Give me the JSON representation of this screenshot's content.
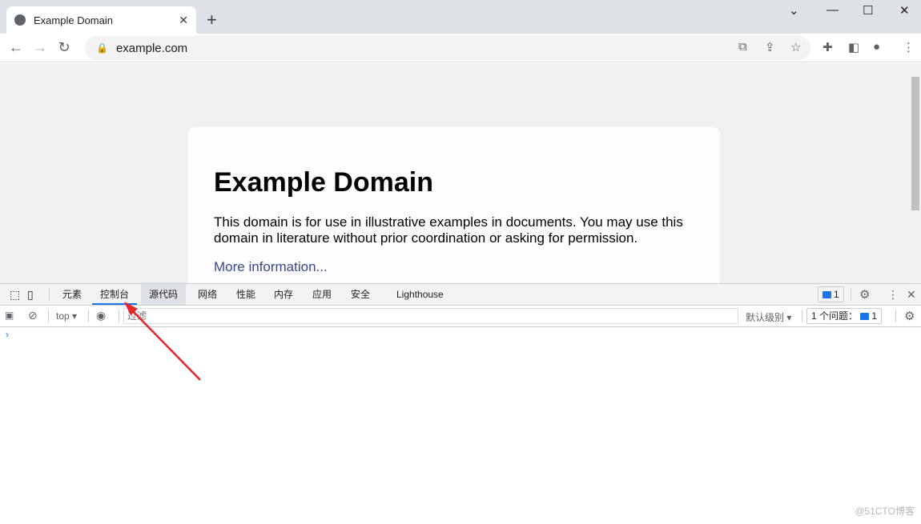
{
  "browser": {
    "tab_title": "Example Domain",
    "url": "example.com"
  },
  "page": {
    "heading": "Example Domain",
    "paragraph": "This domain is for use in illustrative examples in documents. You may use this domain in literature without prior coordination or asking for permission.",
    "link": "More information..."
  },
  "devtools": {
    "tabs": [
      "元素",
      "控制台",
      "源代码",
      "网络",
      "性能",
      "内存",
      "应用",
      "安全",
      "Lighthouse"
    ],
    "active_tab": "控制台",
    "issues_count": "1",
    "context": "top",
    "filter_placeholder": "过滤",
    "level": "默认级别",
    "issues_label": "1 个问题：",
    "issues_badge": "1",
    "prompt": "›"
  },
  "annotation": {
    "arrow_color": "#e8262a"
  },
  "watermark": "@51CTO博客"
}
